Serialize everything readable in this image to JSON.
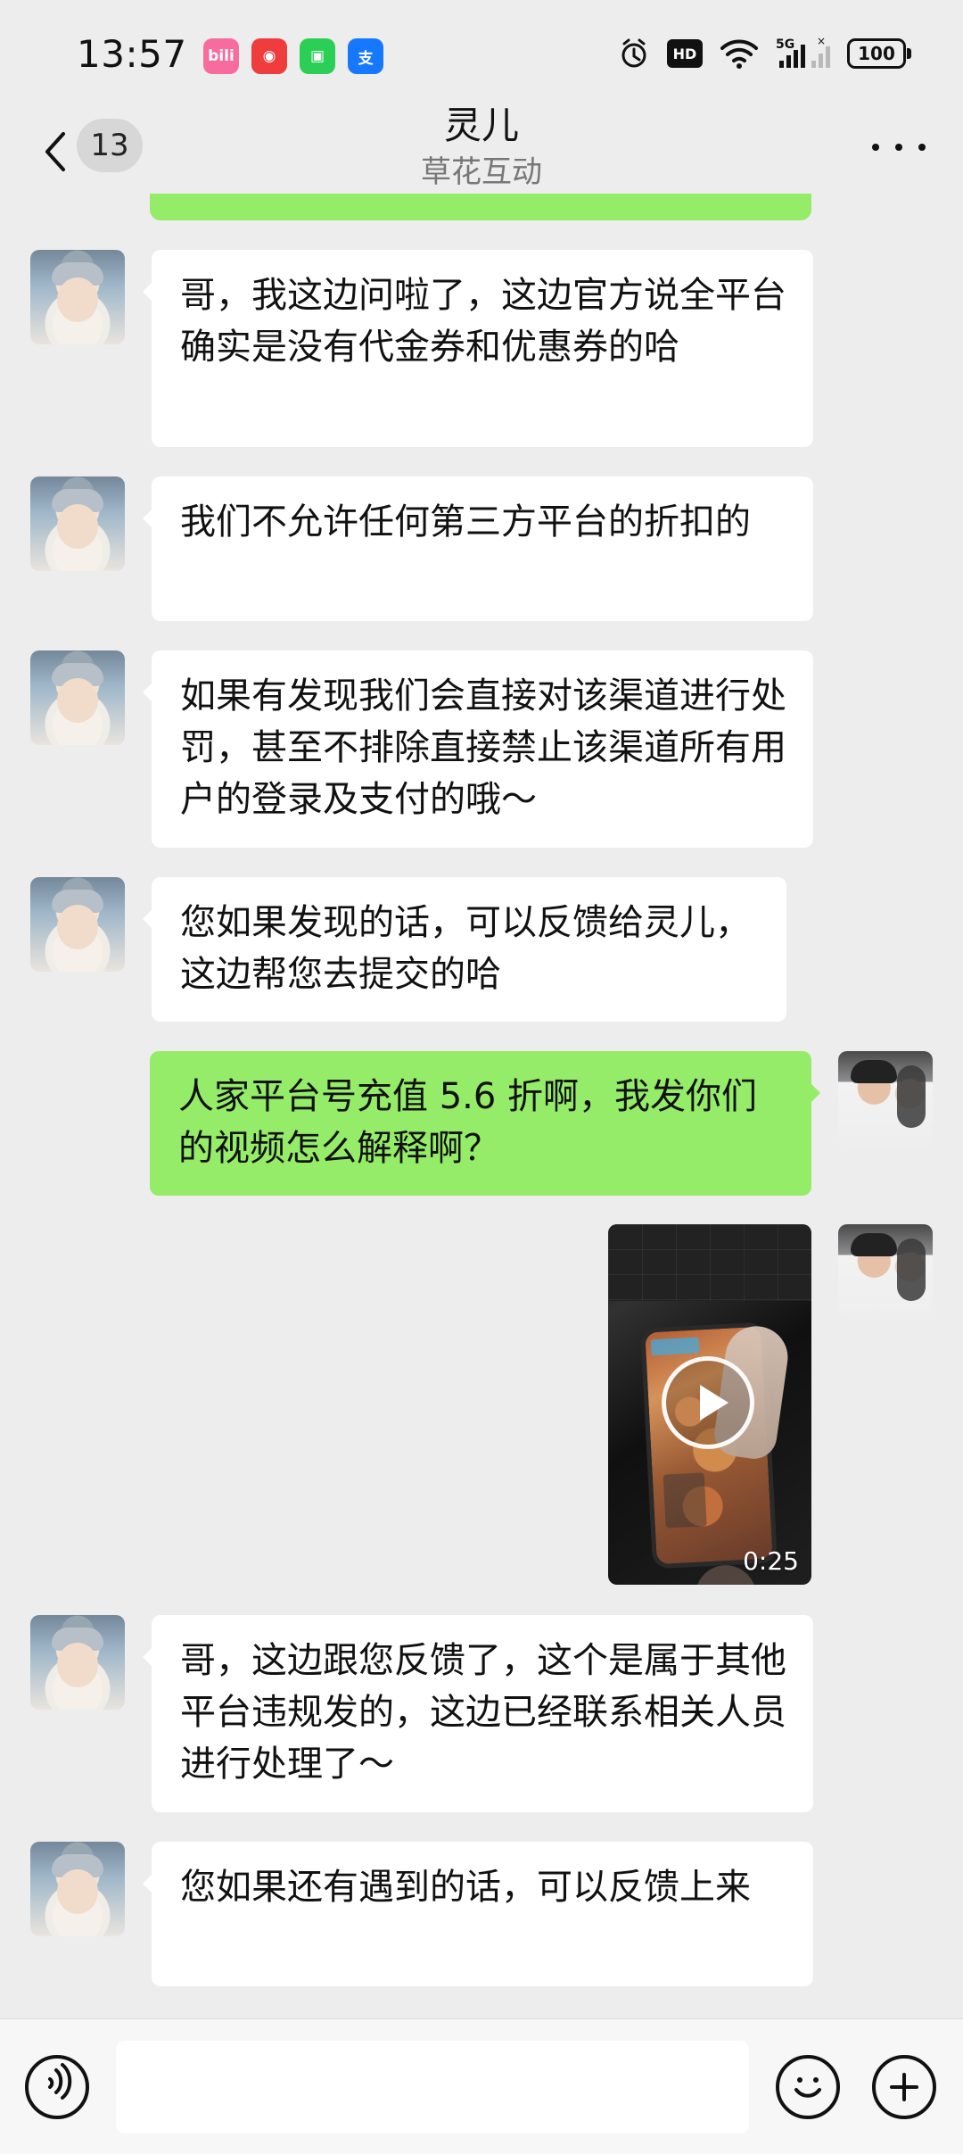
{
  "status_bar": {
    "time": "13:57",
    "app_icons": [
      {
        "name": "bilibili-icon",
        "label": "bili",
        "color": "#f76c9c"
      },
      {
        "name": "netease-music-icon",
        "label": "◉",
        "color": "#ef3c3c"
      },
      {
        "name": "messages-icon",
        "label": "▣",
        "color": "#2ccf56"
      },
      {
        "name": "alipay-icon",
        "label": "支",
        "color": "#1677ff"
      }
    ],
    "hd": "HD",
    "network": "5G",
    "battery": "100"
  },
  "header": {
    "back_badge": "13",
    "title": "灵儿",
    "subtitle": "草花互动"
  },
  "messages": [
    {
      "type": "text",
      "side": "other",
      "text": "哥，我这边问啦了，这边官方说全平台确实是没有代金券和优惠券的哈"
    },
    {
      "type": "text",
      "side": "other",
      "text": "我们不允许任何第三方平台的折扣的"
    },
    {
      "type": "text",
      "side": "other",
      "text": "如果有发现我们会直接对该渠道进行处罚，甚至不排除直接禁止该渠道所有用户的登录及支付的哦～"
    },
    {
      "type": "text",
      "side": "other",
      "text": "您如果发现的话，可以反馈给灵儿，这边帮您去提交的哈"
    },
    {
      "type": "text",
      "side": "self",
      "text": "人家平台号充值 5.6 折啊，我发你们的视频怎么解释啊？"
    },
    {
      "type": "video",
      "side": "self",
      "duration": "0:25"
    },
    {
      "type": "text",
      "side": "other",
      "text": "哥，这边跟您反馈了，这个是属于其他平台违规发的，这边已经联系相关人员进行处理了～"
    },
    {
      "type": "text",
      "side": "other",
      "text": "您如果还有遇到的话，可以反馈上来"
    }
  ],
  "input_bar": {
    "placeholder": ""
  },
  "colors": {
    "chat_background": "#ededed",
    "self_bubble": "#95ec69",
    "other_bubble": "#ffffff"
  }
}
